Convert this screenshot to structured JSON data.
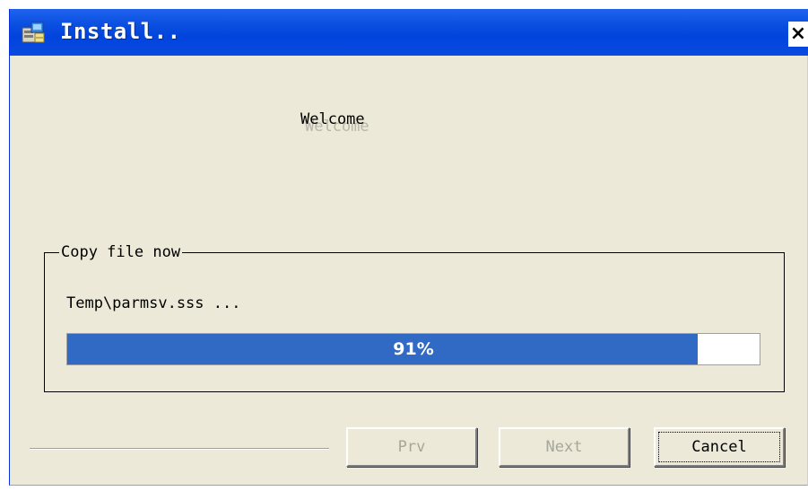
{
  "window": {
    "title": "Install..",
    "close_label": "×"
  },
  "welcome": {
    "text": "Welcome",
    "shadow_text": "Welcome"
  },
  "copy_group": {
    "legend": "Copy file now",
    "current_file": "Temp\\parmsv.sss ...",
    "progress": {
      "value": 91,
      "label": "91%"
    }
  },
  "buttons": {
    "prev": {
      "label": "Prv",
      "enabled": false
    },
    "next": {
      "label": "Next",
      "enabled": false
    },
    "cancel": {
      "label": "Cancel",
      "enabled": true
    }
  },
  "colors": {
    "titlebar": "#0a4ee0",
    "window_bg": "#ece9d8",
    "progress_fill": "#316ac5"
  },
  "icons": {
    "title_icon": "installer-icon"
  }
}
